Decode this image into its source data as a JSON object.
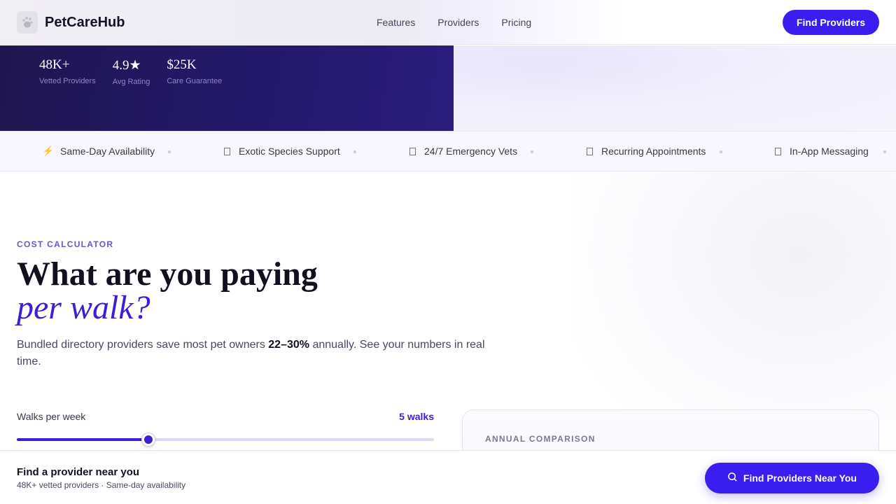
{
  "header": {
    "brand": "PetCareHub",
    "logo_icon": "paw-icon",
    "nav": [
      {
        "label": "Features"
      },
      {
        "label": "Providers"
      },
      {
        "label": "Pricing"
      }
    ],
    "cta_label": "Find Providers"
  },
  "hero": {
    "stats": [
      {
        "value": "48K+",
        "label": "Vetted Providers"
      },
      {
        "value": "4.9★",
        "label": "Avg Rating"
      },
      {
        "value": "$25K",
        "label": "Care Guarantee"
      }
    ]
  },
  "ticker": {
    "items": [
      {
        "icon": "lightning-icon",
        "glyph": "⚡",
        "label": "Same-Day Availability"
      },
      {
        "icon": "lizard-icon",
        "glyph": "",
        "label": "Exotic Species Support"
      },
      {
        "icon": "hospital-icon",
        "glyph": "",
        "label": "24/7 Emergency Vets"
      },
      {
        "icon": "calendar-icon",
        "glyph": "",
        "label": "Recurring Appointments"
      },
      {
        "icon": "chat-icon",
        "glyph": "",
        "label": "In-App Messaging"
      }
    ]
  },
  "calculator": {
    "eyebrow": "COST CALCULATOR",
    "headline": "What are you paying",
    "headline_accent": "per walk?",
    "lead_before": "Bundled directory providers save most pet owners ",
    "lead_bold": "22–30%",
    "lead_after": " annually. See your numbers in real time.",
    "slider": {
      "label": "Walks per week",
      "value_text": "5 walks",
      "fraction": 0.315
    },
    "card_title": "ANNUAL COMPARISON"
  },
  "bottom_bar": {
    "title": "Find a provider near you",
    "subtitle": "48K+ vetted providers · Same-day availability",
    "cta_label": "Find Providers Near You",
    "cta_icon": "search-icon"
  },
  "colors": {
    "accent": "#3a1ef0",
    "hero_dark": "#23186a",
    "eyebrow": "#6a52d8"
  }
}
